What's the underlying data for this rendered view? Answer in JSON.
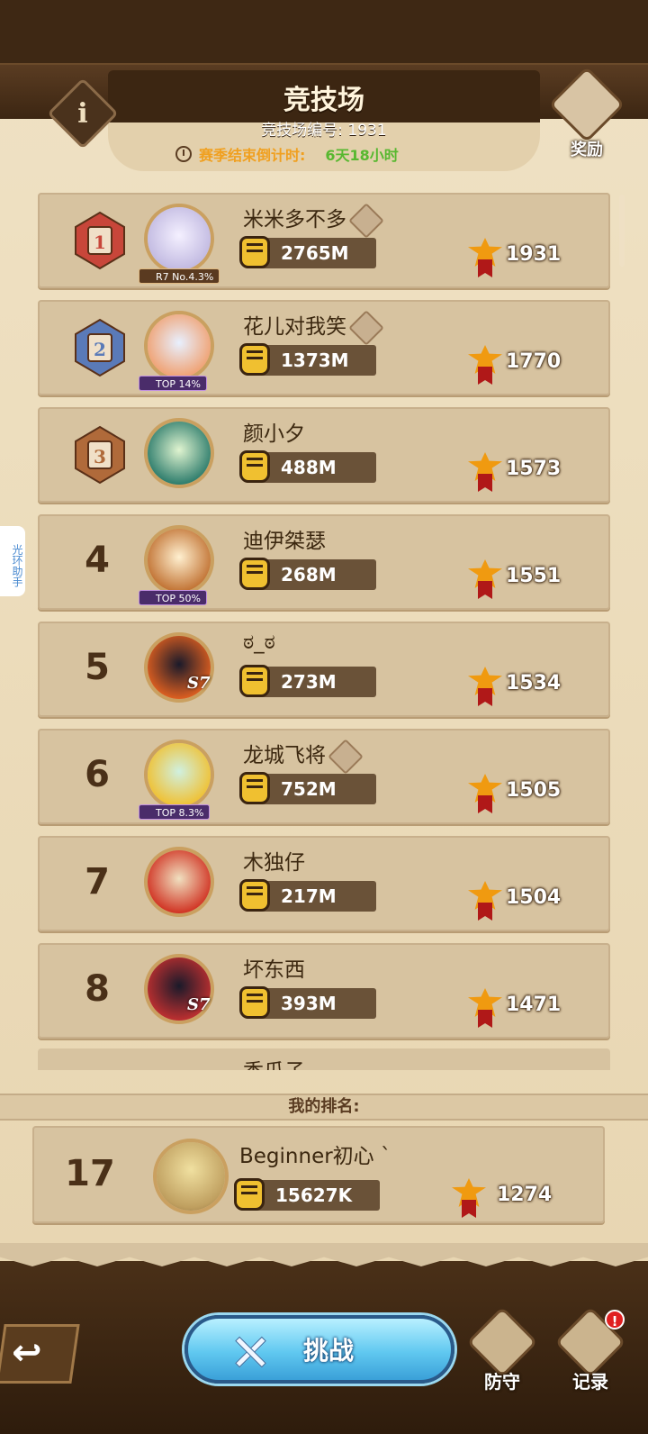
{
  "header": {
    "title": "竞技场",
    "arena_number": "竞技场编号: 1931",
    "countdown_label": "赛季结束倒计时:",
    "countdown_value": "6天18小时",
    "reward_label": "奖励"
  },
  "side_tab": "光环助手",
  "ranking": [
    {
      "rank": "1",
      "name": "米米多不多",
      "badge": "R7 No.4.3%",
      "power": "2765M",
      "score": "1931",
      "accent": "#c8463a"
    },
    {
      "rank": "2",
      "name": "花儿对我笑",
      "badge": "TOP 14%",
      "power": "1373M",
      "score": "1770",
      "accent": "#5a7ab8"
    },
    {
      "rank": "3",
      "name": "颜小夕",
      "badge": "",
      "power": "488M",
      "score": "1573",
      "accent": "#b06a3a"
    },
    {
      "rank": "4",
      "name": "迪伊桀瑟",
      "badge": "TOP 50%",
      "power": "268M",
      "score": "1551"
    },
    {
      "rank": "5",
      "name": "ಠ_ಠ",
      "badge": "",
      "power": "273M",
      "score": "1534",
      "tag": "S7"
    },
    {
      "rank": "6",
      "name": "龙城飞将",
      "badge": "TOP 8.3%",
      "power": "752M",
      "score": "1505"
    },
    {
      "rank": "7",
      "name": "木独仔",
      "badge": "",
      "power": "217M",
      "score": "1504"
    },
    {
      "rank": "8",
      "name": "坏东西",
      "badge": "",
      "power": "393M",
      "score": "1471",
      "tag": "S7"
    }
  ],
  "partial_row_name": "香瓜子",
  "my_rank": {
    "heading": "我的排名:",
    "rank": "17",
    "name": "Beginner初心 `",
    "power": "15627K",
    "score": "1274"
  },
  "bottom": {
    "challenge_label": "挑战",
    "defense_label": "防守",
    "record_label": "记录",
    "record_alert": "!"
  },
  "colors": {
    "panel": "#efe1c3",
    "row": "#d7c3a0",
    "dark_wood": "#3e2814",
    "gold": "#f0c030",
    "trophy": "#f09a10"
  }
}
